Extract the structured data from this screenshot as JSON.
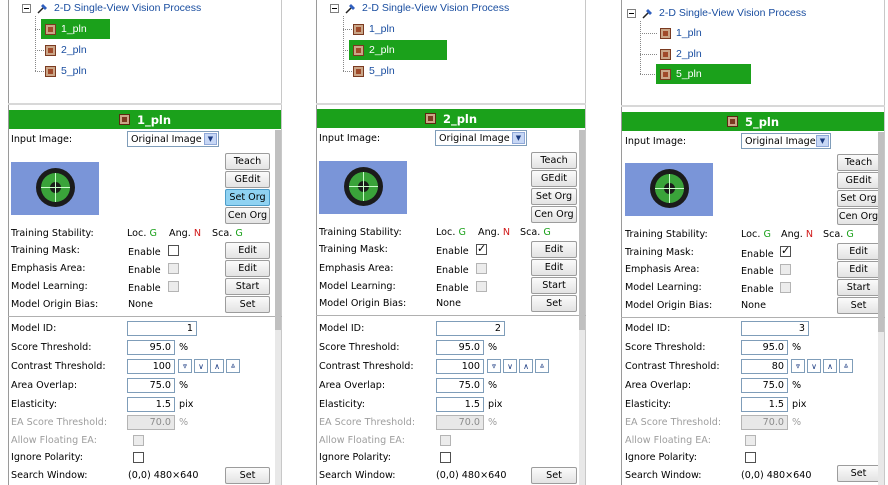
{
  "tree": {
    "root_label": "2-D Single-View Vision Process",
    "items": [
      "1_pln",
      "2_pln",
      "5_pln"
    ]
  },
  "labels": {
    "input_image": "Input Image:",
    "training_stability": "Training Stability:",
    "training_mask": "Training Mask:",
    "emphasis_area": "Emphasis Area:",
    "model_learning": "Model Learning:",
    "model_origin_bias": "Model Origin Bias:",
    "model_id": "Model ID:",
    "score_threshold": "Score Threshold:",
    "contrast_threshold": "Contrast Threshold:",
    "area_overlap": "Area Overlap:",
    "elasticity": "Elasticity:",
    "ea_score_threshold": "EA Score Threshold:",
    "allow_floating_ea": "Allow Floating EA:",
    "ignore_polarity": "Ignore Polarity:",
    "search_window": "Search Window:"
  },
  "stability": {
    "loc": "Loc.",
    "loc_val": "G",
    "ang": "Ang.",
    "ang_val": "N",
    "sca": "Sca.",
    "sca_val": "G"
  },
  "buttons": {
    "teach": "Teach",
    "gedit": "GEdit",
    "set_org": "Set Org",
    "cen_org": "Cen Org",
    "edit": "Edit",
    "start": "Start",
    "set": "Set"
  },
  "common": {
    "input_image_value": "Original Image",
    "enable": "Enable",
    "none": "None",
    "percent": "%",
    "pix": "pix",
    "score_threshold": "95.0",
    "area_overlap": "75.0",
    "elasticity": "1.5",
    "ea_score_threshold": "70.0",
    "search_window": "(0,0) 480×640"
  },
  "panels": [
    {
      "header": "1_pln",
      "model_id": "1",
      "contrast": "100",
      "mask_checked": false
    },
    {
      "header": "2_pln",
      "model_id": "2",
      "contrast": "100",
      "mask_checked": true
    },
    {
      "header": "5_pln",
      "model_id": "3",
      "contrast": "80",
      "mask_checked": true
    }
  ],
  "icons": {
    "tree_root": "vision-process-icon",
    "tree_item": "pln-icon",
    "select_arrow": "chevron-down-icon",
    "threshold_buttons": [
      "double-chevron-down-icon",
      "chevron-down-icon",
      "chevron-up-icon",
      "double-chevron-up-icon"
    ]
  },
  "colors": {
    "accent_green": "#1ba11b",
    "tree_text": "#1a4ea0",
    "stability_good": "#1ba11b",
    "stability_bad": "#d01818"
  }
}
